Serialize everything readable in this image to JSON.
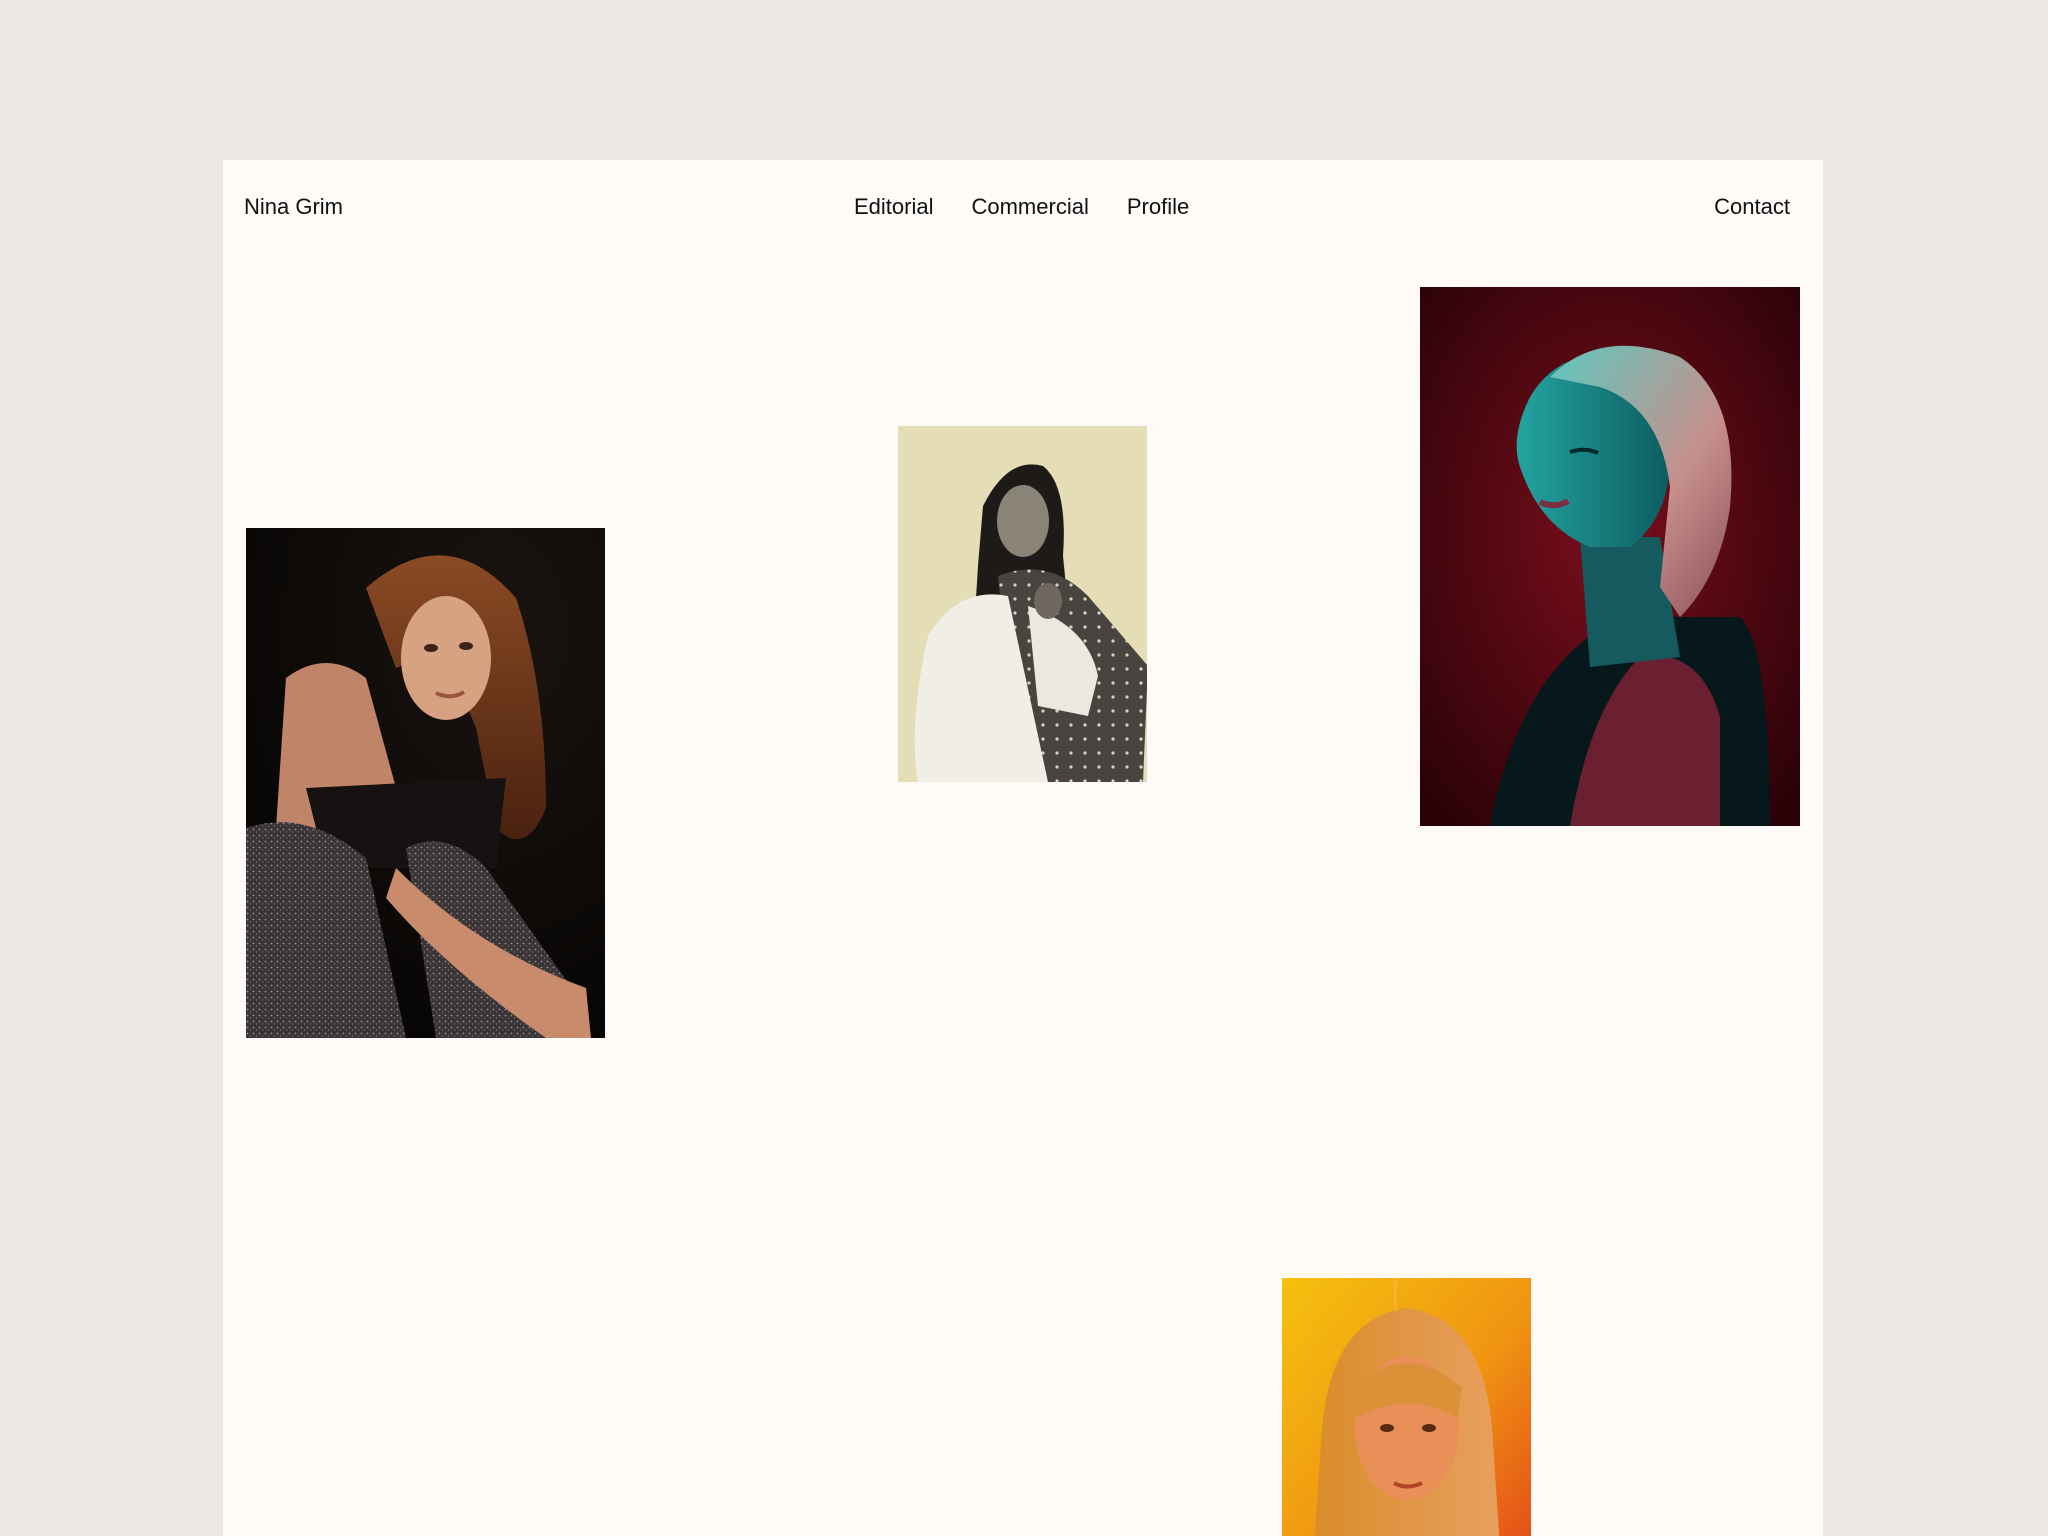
{
  "header": {
    "brand": "Nina Grim",
    "nav": [
      "Editorial",
      "Commercial",
      "Profile"
    ],
    "contact": "Contact"
  },
  "photos": [
    {
      "name": "portrait-sitting-warm"
    },
    {
      "name": "portrait-duotone-beige"
    },
    {
      "name": "portrait-profile-teal-red"
    },
    {
      "name": "portrait-orange-glow"
    }
  ],
  "colors": {
    "background": "#ebe7e2",
    "page": "#fdfaf8",
    "text": "#111111"
  }
}
